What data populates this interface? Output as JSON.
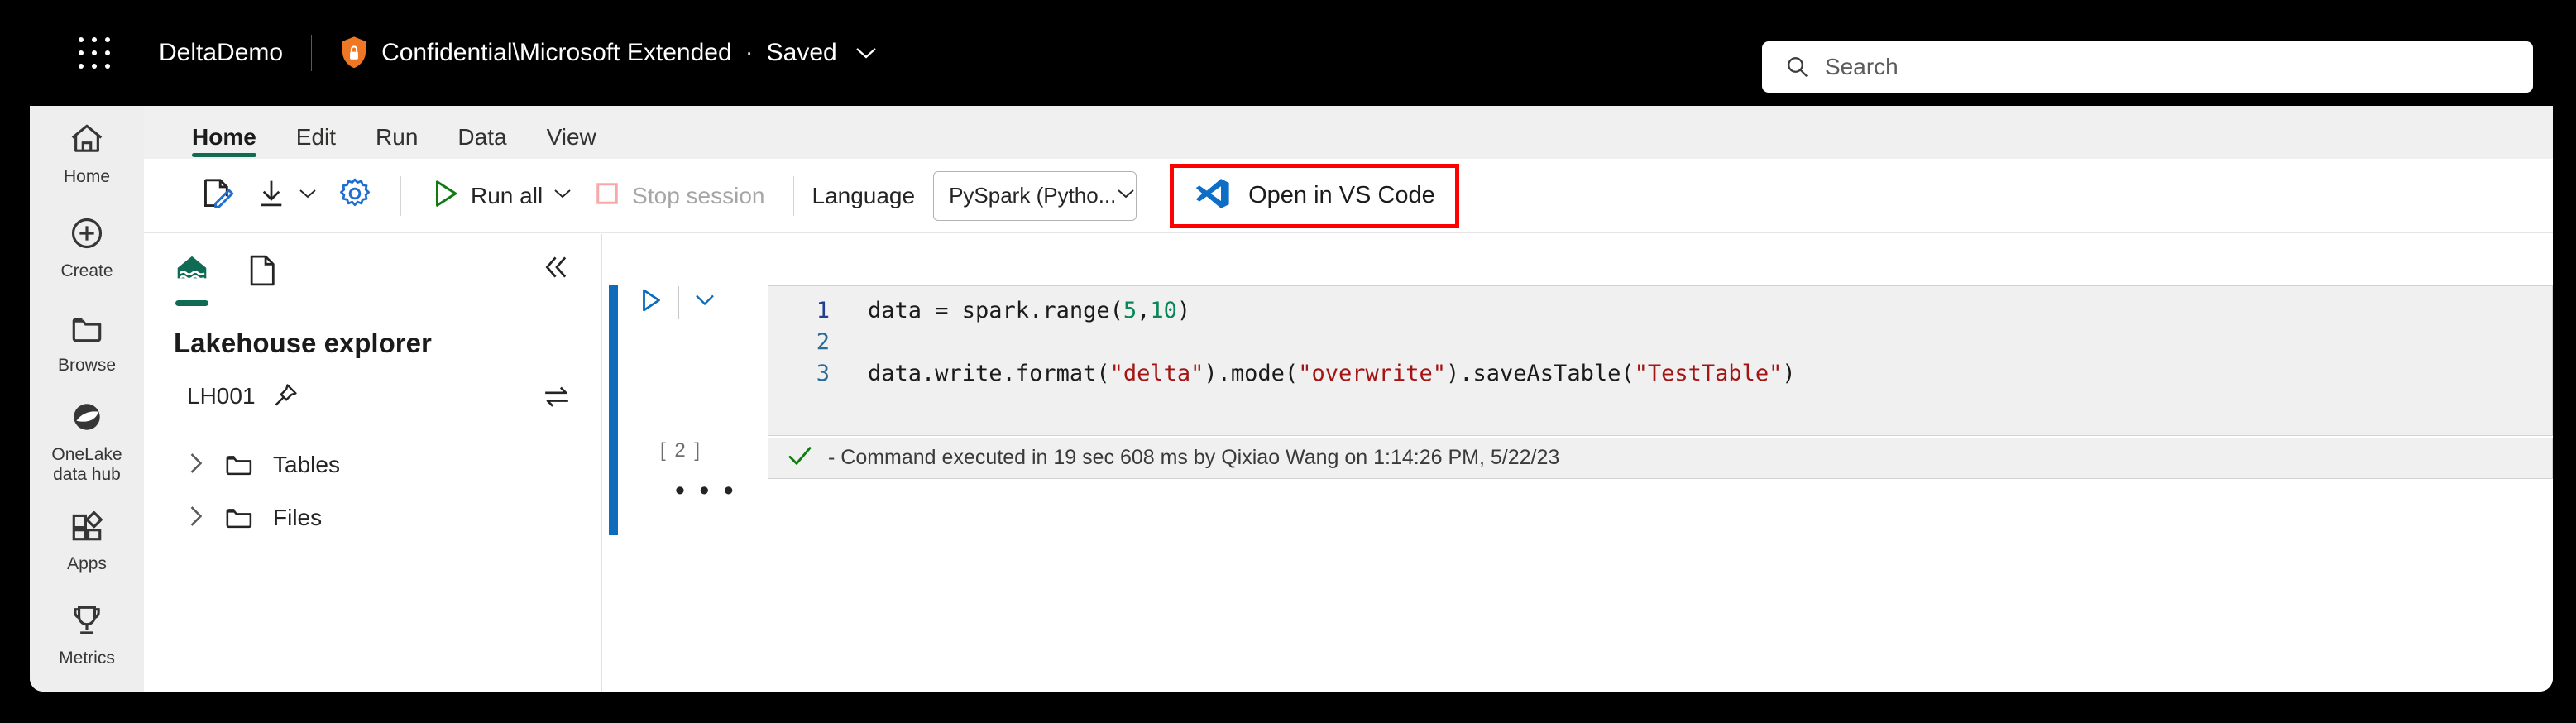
{
  "header": {
    "waffle_icon": "app-launcher-icon",
    "app_name": "DeltaDemo",
    "sensitivity_icon": "shield-lock-icon",
    "sensitivity_label": "Confidential\\Microsoft Extended",
    "separator": "·",
    "save_state": "Saved",
    "chevron_icon": "chevron-down-icon"
  },
  "search": {
    "icon": "search-icon",
    "placeholder": "Search",
    "value": ""
  },
  "rail": {
    "items": [
      {
        "label": "Home",
        "icon": "home-icon"
      },
      {
        "label": "Create",
        "icon": "plus-circle-icon"
      },
      {
        "label": "Browse",
        "icon": "folder-icon"
      },
      {
        "label": "OneLake\ndata hub",
        "icon": "onelake-icon"
      },
      {
        "label": "Apps",
        "icon": "apps-grid-icon"
      },
      {
        "label": "Metrics",
        "icon": "trophy-icon"
      }
    ]
  },
  "ribbon": {
    "tabs": [
      {
        "label": "Home",
        "active": true
      },
      {
        "label": "Edit",
        "active": false
      },
      {
        "label": "Run",
        "active": false
      },
      {
        "label": "Data",
        "active": false
      },
      {
        "label": "View",
        "active": false
      }
    ]
  },
  "toolbar": {
    "edit_icon": "document-edit-icon",
    "download_icon": "download-icon",
    "download_chevron_icon": "chevron-down-icon",
    "settings_icon": "gear-icon",
    "run_all_icon": "play-triangle-icon",
    "run_all_label": "Run all",
    "run_all_chevron_icon": "chevron-down-icon",
    "stop_icon": "stop-square-icon",
    "stop_label": "Stop session",
    "language_label": "Language",
    "language_value": "PySpark (Pytho...",
    "language_chevron_icon": "chevron-down-icon",
    "vscode_icon": "vscode-logo-icon",
    "vscode_label": "Open in VS Code",
    "highlight_color": "#ff0000"
  },
  "explorer": {
    "lakehouse_tab_icon": "lakehouse-house-water-icon",
    "document_tab_icon": "document-icon",
    "collapse_icon": "chevron-double-left-icon",
    "title": "Lakehouse explorer",
    "lakehouse_name": "LH001",
    "pin_icon": "pin-icon",
    "swap_icon": "swap-arrows-icon",
    "tree": [
      {
        "label": "Tables",
        "expand_icon": "chevron-right-icon",
        "folder_icon": "folder-icon"
      },
      {
        "label": "Files",
        "expand_icon": "chevron-right-icon",
        "folder_icon": "folder-icon"
      }
    ]
  },
  "notebook": {
    "run_cell_icon": "play-triangle-icon",
    "cell_chevron_icon": "chevron-down-icon",
    "execution_count": "[ 2 ]",
    "more_options": "• • •",
    "lines": [
      {
        "number": "1",
        "segments": [
          {
            "text": "data = spark.range(",
            "type": "plain"
          },
          {
            "text": "5",
            "type": "number"
          },
          {
            "text": ",",
            "type": "plain"
          },
          {
            "text": "10",
            "type": "number"
          },
          {
            "text": ")",
            "type": "plain"
          }
        ]
      },
      {
        "number": "2",
        "segments": [
          {
            "text": "",
            "type": "plain"
          }
        ]
      },
      {
        "number": "3",
        "segments": [
          {
            "text": "data.write.format(",
            "type": "plain"
          },
          {
            "text": "\"delta\"",
            "type": "string"
          },
          {
            "text": ").mode(",
            "type": "plain"
          },
          {
            "text": "\"overwrite\"",
            "type": "string"
          },
          {
            "text": ").saveAsTable(",
            "type": "plain"
          },
          {
            "text": "\"TestTable\"",
            "type": "string"
          },
          {
            "text": ")",
            "type": "plain"
          }
        ]
      }
    ],
    "status": {
      "check_icon": "checkmark-icon",
      "text": "- Command executed in 19 sec 608 ms by Qixiao Wang on 1:14:26 PM, 5/22/23"
    }
  },
  "colors": {
    "accent_teal": "#0f6b53",
    "accent_blue": "#0f6cbd",
    "success_green": "#107c10",
    "string_red": "#a31515",
    "number_green": "#098658",
    "topbar_black": "#000000"
  }
}
